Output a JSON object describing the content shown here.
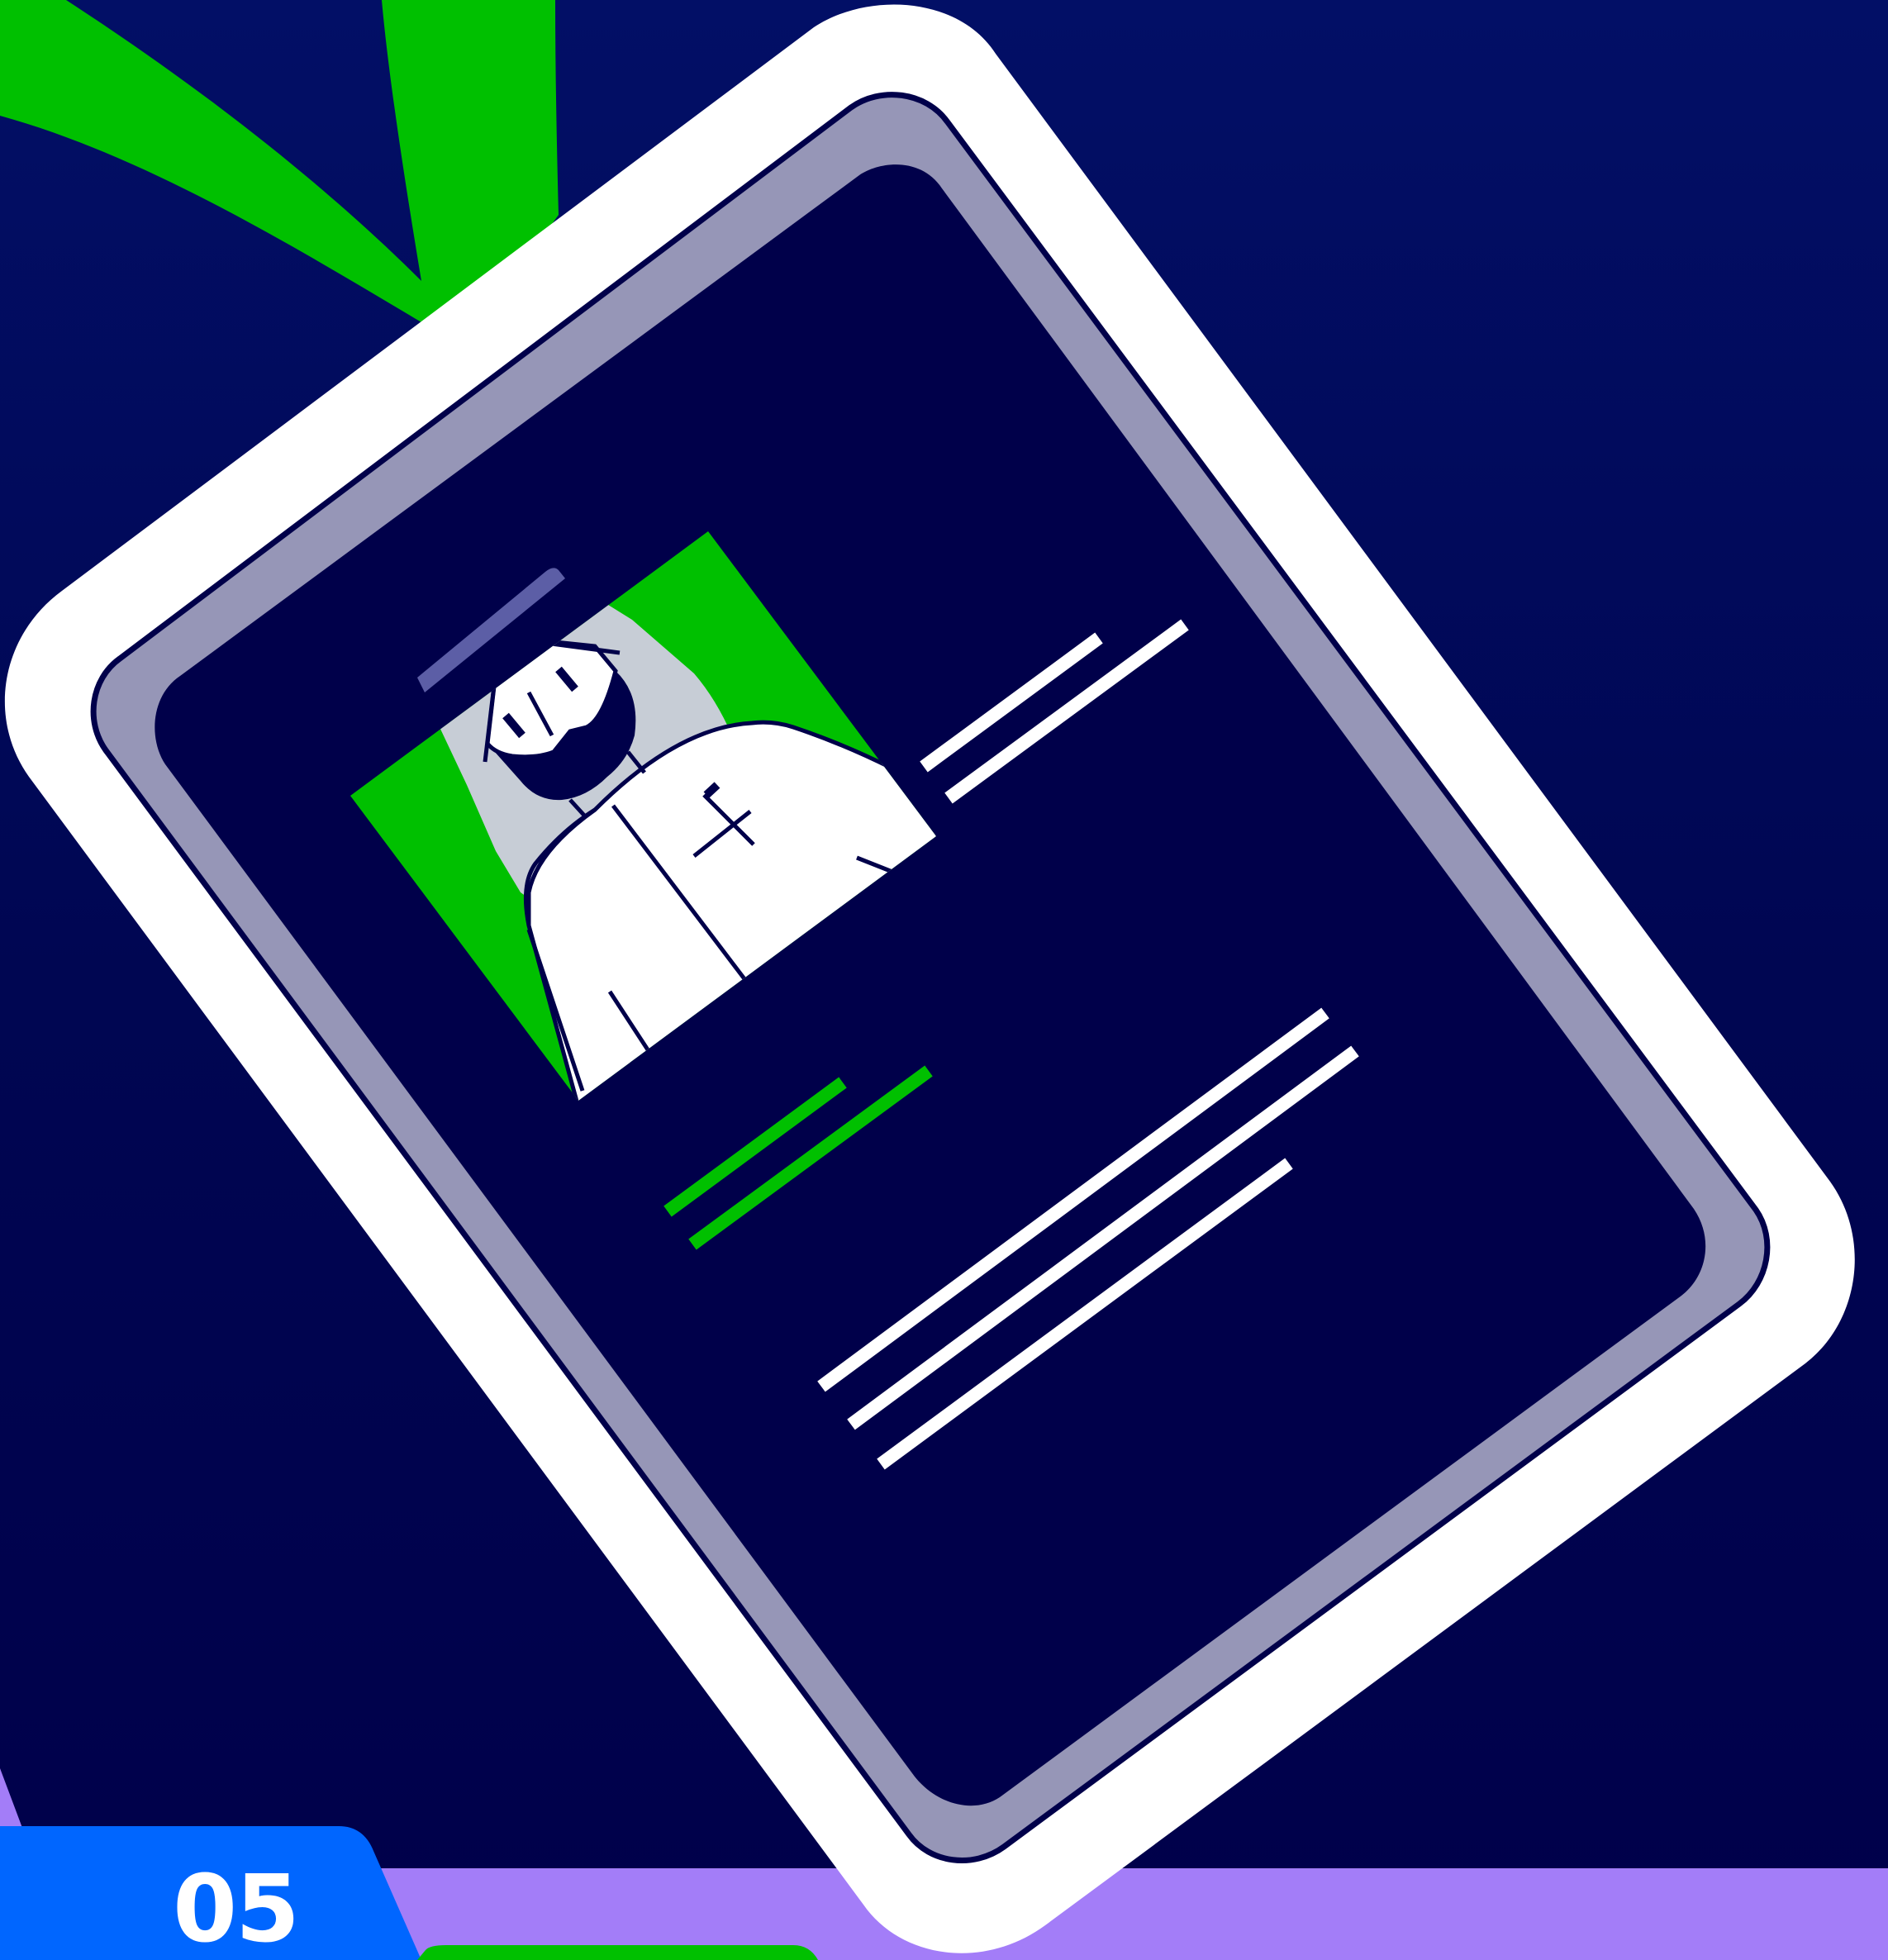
{
  "step": {
    "number": "05"
  },
  "colors": {
    "background_top": "#020f66",
    "background_bottom": "#00004a",
    "lanyard": "#00c000",
    "card_frame": "#ffffff",
    "card_inner_border": "#9696b7",
    "card_screen": "#00004a",
    "photo_background": "#00c000",
    "highlight_lines": "#00c000",
    "text_lines": "#ffffff",
    "floor_band": "#a37df8",
    "badge_tab": "#0066ff",
    "badge_number": "#ffffff"
  },
  "icons": {
    "card": "id-badge-icon",
    "person": "doctor-avatar-icon",
    "cross": "medical-cross-icon",
    "lanyard": "lanyard-icon"
  }
}
